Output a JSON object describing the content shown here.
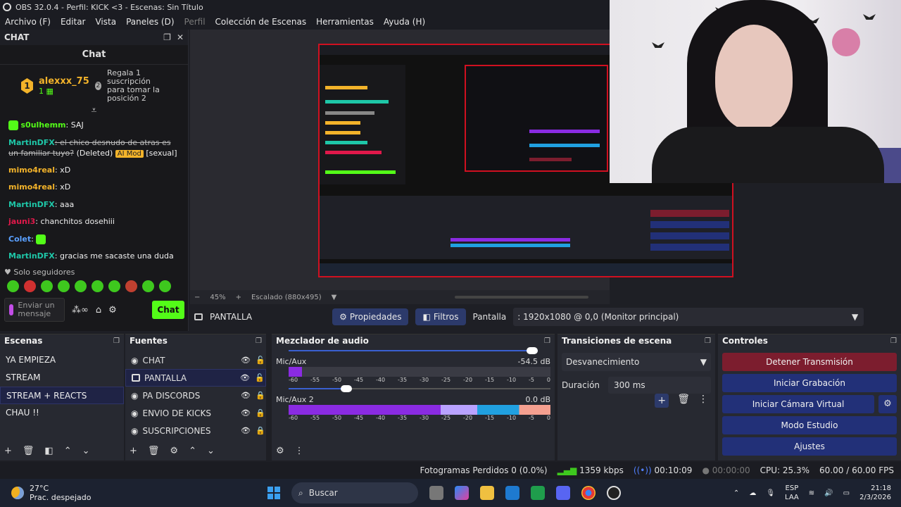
{
  "window": {
    "title": "OBS 32.0.4 - Perfil: KICK <3 - Escenas: Sin Título"
  },
  "menu": [
    "Archivo (F)",
    "Editar",
    "Vista",
    "Paneles (D)",
    "Perfil",
    "Colección de Escenas",
    "Herramientas",
    "Ayuda (H)"
  ],
  "chat_dock": {
    "title": "CHAT",
    "header": "Chat",
    "pinned": {
      "rank": "1",
      "user": "alexxx_75",
      "count": "1",
      "rank2": "2",
      "text": "Regala 1 suscripción para tomar la posición 2"
    },
    "messages": [
      {
        "user": "s0ulhemm",
        "color": "#53fc18",
        "text": ": SAJ"
      },
      {
        "user": "MartinDFX",
        "color": "#1ec7a8",
        "text": ": el chico desnudo de atras es un familiar tuyo?",
        "deleted": "(Deleted)",
        "badge": "AI Mod",
        "tag": "[sexual]"
      },
      {
        "user": "mimo4real",
        "color": "#f3b32a",
        "text": ": xD"
      },
      {
        "user": "mimo4real",
        "color": "#f3b32a",
        "text": ": xD"
      },
      {
        "user": "MartinDFX",
        "color": "#1ec7a8",
        "text": ": aaa"
      },
      {
        "user": "jauni3",
        "color": "#e0184a",
        "text": ": chanchitos dosehiii"
      },
      {
        "user": "Colet",
        "color": "#5aa0ff",
        "text": ":"
      },
      {
        "user": "MartinDFX",
        "color": "#1ec7a8",
        "text": ": gracias me sacaste una duda"
      }
    ],
    "followers": "Solo seguidores",
    "input_placeholder": "Enviar un mensaje",
    "send_label": "Chat"
  },
  "zoom": {
    "percent": "45%",
    "scale": "Escalado (880x495)"
  },
  "source_toolbar": {
    "source_name": "PANTALLA",
    "properties": "Propiedades",
    "filters": "Filtros",
    "display_label": "Pantalla",
    "display_value": ": 1920x1080 @ 0,0 (Monitor principal)"
  },
  "scenes": {
    "title": "Escenas",
    "items": [
      "YA EMPIEZA",
      "STREAM",
      "STREAM + REACTS",
      "CHAU !!"
    ],
    "selected": 2
  },
  "sources": {
    "title": "Fuentes",
    "items": [
      "CHAT",
      "PANTALLA",
      "PA DISCORDS",
      "ENVIO DE KICKS",
      "SUSCRIPCIONES"
    ]
  },
  "mixer": {
    "title": "Mezclador de audio",
    "channels": [
      {
        "name": "Mic/Aux",
        "db": "-54.5 dB",
        "level": 0.05,
        "volume": 0.22,
        "muted": true
      },
      {
        "name": "Mic/Aux 2",
        "db": "0.0 dB",
        "level": 1.0,
        "volume": 1.0,
        "muted": false
      }
    ],
    "ticks": [
      "-60",
      "-55",
      "-50",
      "-45",
      "-40",
      "-35",
      "-30",
      "-25",
      "-20",
      "-15",
      "-10",
      "-5",
      "0"
    ]
  },
  "transitions": {
    "title": "Transiciones de escena",
    "type": "Desvanecimiento",
    "duration_label": "Duración",
    "duration_value": "300 ms"
  },
  "controls": {
    "title": "Controles",
    "stop_stream": "Detener Transmisión",
    "start_recording": "Iniciar Grabación",
    "start_vcam": "Iniciar Cámara Virtual",
    "studio_mode": "Modo Estudio",
    "settings": "Ajustes"
  },
  "status": {
    "dropped": "Fotogramas Perdidos 0 (0.0%)",
    "bitrate": "1359 kbps",
    "stream_time": "00:10:09",
    "rec_time": "00:00:00",
    "cpu": "CPU: 25.3%",
    "fps": "60.00 / 60.00 FPS"
  },
  "taskbar": {
    "temp": "27°C",
    "weather": "Prac. despejado",
    "search": "Buscar",
    "lang1": "ESP",
    "lang2": "LAA",
    "time": "21:18",
    "date": "2/3/2026"
  }
}
